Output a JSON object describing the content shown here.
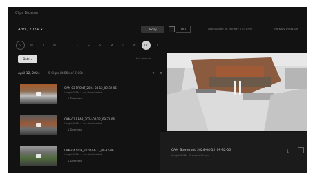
{
  "window": {
    "title": "Clips Browser"
  },
  "header": {
    "month_label": "April, 2024",
    "today_label": "Today",
    "shown_value": "100",
    "status_text": "Last synced on Monday 07:51:09",
    "status_date": "Thursday 09:51:09"
  },
  "day_strip": [
    {
      "label": "S",
      "state": "first"
    },
    {
      "label": "M",
      "state": "normal"
    },
    {
      "label": "T",
      "state": "normal"
    },
    {
      "label": "W",
      "state": "normal"
    },
    {
      "label": "T",
      "state": "normal"
    },
    {
      "label": "F",
      "state": "normal"
    },
    {
      "label": "S",
      "state": "normal"
    },
    {
      "label": "S",
      "state": "normal"
    },
    {
      "label": "M",
      "state": "normal"
    },
    {
      "label": "T",
      "state": "normal"
    },
    {
      "label": "W",
      "state": "normal"
    },
    {
      "label": "12",
      "state": "selected"
    },
    {
      "label": "T",
      "state": "normal"
    }
  ],
  "controls": {
    "sort_label": "Date",
    "side_link": "Full calendar"
  },
  "group": {
    "date": "April 12, 2024",
    "meta": "5 Clips (4:56s of 5:00)",
    "icons": "▾ ≡"
  },
  "clips": [
    {
      "title": "CAM-03 FRONT_2024-04-12_09-32-06",
      "subtitle": "Length 0:48s · Last downloaded",
      "tag": "↓ Download"
    },
    {
      "title": "CAM-01 REAR_2024-04-12_09-32-06",
      "subtitle": "Length 0:48s · Last downloaded",
      "tag": "↓ Download"
    },
    {
      "title": "CAM-04 SIDE_2024-04-12_09-32-06",
      "subtitle": "Length 0:48s · Last downloaded",
      "tag": "↓ Download"
    }
  ],
  "player": {
    "title": "CAM_Storefront_2024-04-12_09-32-06",
    "subtitle": "Length 0:48s · Shared with you",
    "download_icon": "download-icon",
    "expand_icon": "expand-icon"
  },
  "colors": {
    "background": "#121212",
    "panel": "#1b1b1b",
    "accent": "#cfcfcf"
  }
}
